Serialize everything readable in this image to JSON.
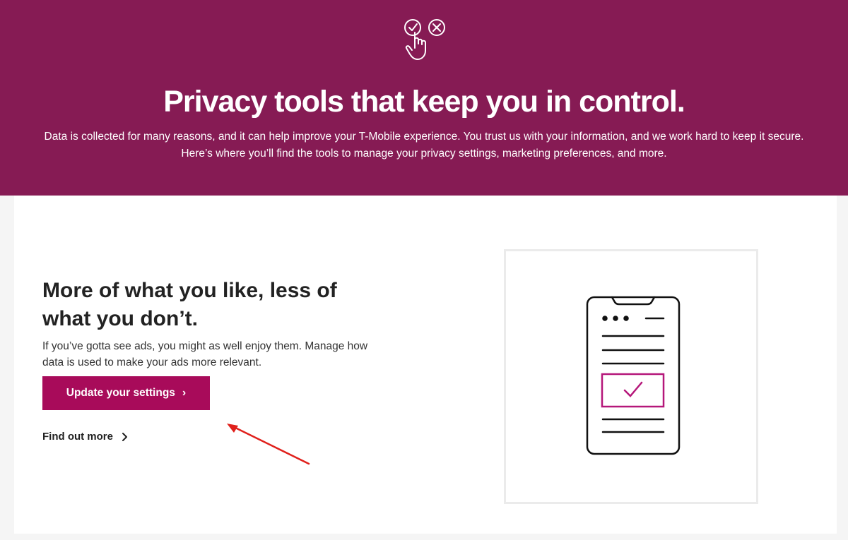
{
  "hero": {
    "icon": "check-cross-hand-icon",
    "title": "Privacy tools that keep you in control.",
    "description": "Data is collected for many reasons, and it can help improve your T-Mobile experience. You trust us with your information, and we work hard to keep it secure. Here’s where you’ll find the tools to manage your privacy settings, marketing preferences, and more."
  },
  "card": {
    "title": "More of what you like, less of what you don’t.",
    "description": "If you’ve gotta see ads, you might as well enjoy them. Manage how data is used to make your ads more relevant.",
    "primary_button": "Update your settings",
    "secondary_link": "Find out more",
    "illustration_icon": "phone-checklist-icon"
  },
  "colors": {
    "brand": "#861b54",
    "button": "#a80b5a",
    "annotation_arrow": "#e0201b"
  }
}
